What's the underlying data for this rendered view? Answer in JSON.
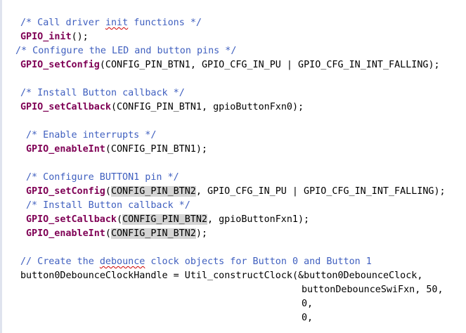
{
  "editor": {
    "lines": [
      {
        "id": "l1",
        "parts": [
          {
            "t": "/* Call driver ",
            "c": "cmt"
          },
          {
            "t": "init",
            "c": "cmt sq"
          },
          {
            "t": " functions */",
            "c": "cmt"
          }
        ]
      },
      {
        "id": "l2",
        "parts": [
          {
            "t": "GPIO_init",
            "c": "fn"
          },
          {
            "t": "();",
            "c": "plain"
          }
        ]
      },
      {
        "id": "l3",
        "parts": [
          {
            "t": "/* Configure the LED and button pins */",
            "c": "cmt"
          }
        ]
      },
      {
        "id": "l4",
        "parts": [
          {
            "t": "GPIO_setConfig",
            "c": "fn"
          },
          {
            "t": "(CONFIG_PIN_BTN1, GPIO_CFG_IN_PU | GPIO_CFG_IN_INT_FALLING);",
            "c": "plain"
          }
        ]
      },
      {
        "id": "l5",
        "parts": [
          {
            "t": "/* Install Button callback */",
            "c": "cmt"
          }
        ]
      },
      {
        "id": "l6",
        "parts": [
          {
            "t": "GPIO_setCallback",
            "c": "fn"
          },
          {
            "t": "(CONFIG_PIN_BTN1, gpioButtonFxn0);",
            "c": "plain"
          }
        ]
      },
      {
        "id": "l7",
        "parts": [
          {
            "t": "/* Enable interrupts */",
            "c": "cmt"
          }
        ]
      },
      {
        "id": "l8",
        "parts": [
          {
            "t": "GPIO_enableInt",
            "c": "fn"
          },
          {
            "t": "(CONFIG_PIN_BTN1);",
            "c": "plain"
          }
        ]
      },
      {
        "id": "l9",
        "parts": [
          {
            "t": "/* Configure BUTTON1 pin */",
            "c": "cmt"
          }
        ]
      },
      {
        "id": "l10",
        "parts": [
          {
            "t": "GPIO_setConfig",
            "c": "fn"
          },
          {
            "t": "(",
            "c": "plain"
          },
          {
            "t": "CONFIG_PIN_BTN2",
            "c": "plain hl"
          },
          {
            "t": ", GPIO_CFG_IN_PU | GPIO_CFG_IN_INT_FALLING);",
            "c": "plain"
          }
        ]
      },
      {
        "id": "l11",
        "parts": [
          {
            "t": "/* Install Button callback */",
            "c": "cmt"
          }
        ]
      },
      {
        "id": "l12",
        "parts": [
          {
            "t": "GPIO_setCallback",
            "c": "fn"
          },
          {
            "t": "(",
            "c": "plain"
          },
          {
            "t": "CONFIG_PIN_BTN2",
            "c": "plain hl"
          },
          {
            "t": ", gpioButtonFxn1);",
            "c": "plain"
          }
        ]
      },
      {
        "id": "l13",
        "parts": [
          {
            "t": "GPIO_enableInt",
            "c": "fn"
          },
          {
            "t": "(",
            "c": "plain"
          },
          {
            "t": "CONFIG_PIN_BTN2",
            "c": "plain hl"
          },
          {
            "t": ");",
            "c": "plain"
          }
        ]
      },
      {
        "id": "l14",
        "parts": [
          {
            "t": "// Create the ",
            "c": "cmt"
          },
          {
            "t": "debounce",
            "c": "cmt sq"
          },
          {
            "t": " clock objects for Button 0 and Button 1",
            "c": "cmt"
          }
        ]
      },
      {
        "id": "l15",
        "parts": [
          {
            "t": "button0DebounceClockHandle = Util_constructClock(&button0DebounceClock,",
            "c": "plain"
          }
        ]
      },
      {
        "id": "l16",
        "parts": [
          {
            "t": "buttonDebounceSwiFxn, 50,",
            "c": "plain"
          }
        ]
      },
      {
        "id": "l17",
        "parts": [
          {
            "t": "0,",
            "c": "plain"
          }
        ]
      },
      {
        "id": "l18",
        "parts": [
          {
            "t": "0,",
            "c": "plain"
          }
        ]
      }
    ]
  },
  "colors": {
    "comment": "#3f5fbf",
    "function": "#7f0055",
    "text": "#000000",
    "selection_highlight": "#d4d4d4",
    "gutter": "#dfe3ee"
  }
}
